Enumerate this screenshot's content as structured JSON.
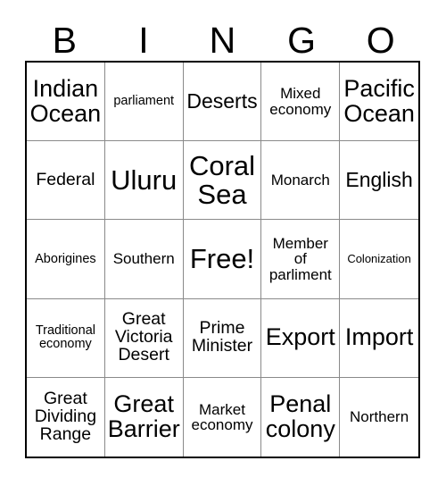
{
  "card": {
    "header_letters": [
      "B",
      "I",
      "N",
      "G",
      "O"
    ],
    "rows": [
      [
        {
          "text": "Indian\nOcean",
          "size": "fs-2xl"
        },
        {
          "text": "parliament",
          "size": "fs-sm"
        },
        {
          "text": "Deserts",
          "size": "fs-xl"
        },
        {
          "text": "Mixed\neconomy",
          "size": "fs-md"
        },
        {
          "text": "Pacific\nOcean",
          "size": "fs-2xl"
        }
      ],
      [
        {
          "text": "Federal",
          "size": "fs-lg"
        },
        {
          "text": "Uluru",
          "size": "fs-3xl"
        },
        {
          "text": "Coral\nSea",
          "size": "fs-3xl"
        },
        {
          "text": "Monarch",
          "size": "fs-md"
        },
        {
          "text": "English",
          "size": "fs-xl"
        }
      ],
      [
        {
          "text": "Aborigines",
          "size": "fs-sm"
        },
        {
          "text": "Southern",
          "size": "fs-md"
        },
        {
          "text": "Free!",
          "size": "fs-3xl"
        },
        {
          "text": "Member\nof\nparliment",
          "size": "fs-md"
        },
        {
          "text": "Colonization",
          "size": "fs-xs"
        }
      ],
      [
        {
          "text": "Traditional\neconomy",
          "size": "fs-sm"
        },
        {
          "text": "Great\nVictoria\nDesert",
          "size": "fs-lg"
        },
        {
          "text": "Prime\nMinister",
          "size": "fs-lg"
        },
        {
          "text": "Export",
          "size": "fs-2xl"
        },
        {
          "text": "Import",
          "size": "fs-2xl"
        }
      ],
      [
        {
          "text": "Great\nDividing\nRange",
          "size": "fs-lg"
        },
        {
          "text": "Great\nBarrier",
          "size": "fs-2xl"
        },
        {
          "text": "Market\neconomy",
          "size": "fs-md"
        },
        {
          "text": "Penal\ncolony",
          "size": "fs-2xl"
        },
        {
          "text": "Northern",
          "size": "fs-md"
        }
      ]
    ]
  },
  "colors": {
    "background": "#ffffff",
    "text": "#000000",
    "grid_outer_border": "#000000",
    "grid_inner_line": "#8a8a8a"
  }
}
